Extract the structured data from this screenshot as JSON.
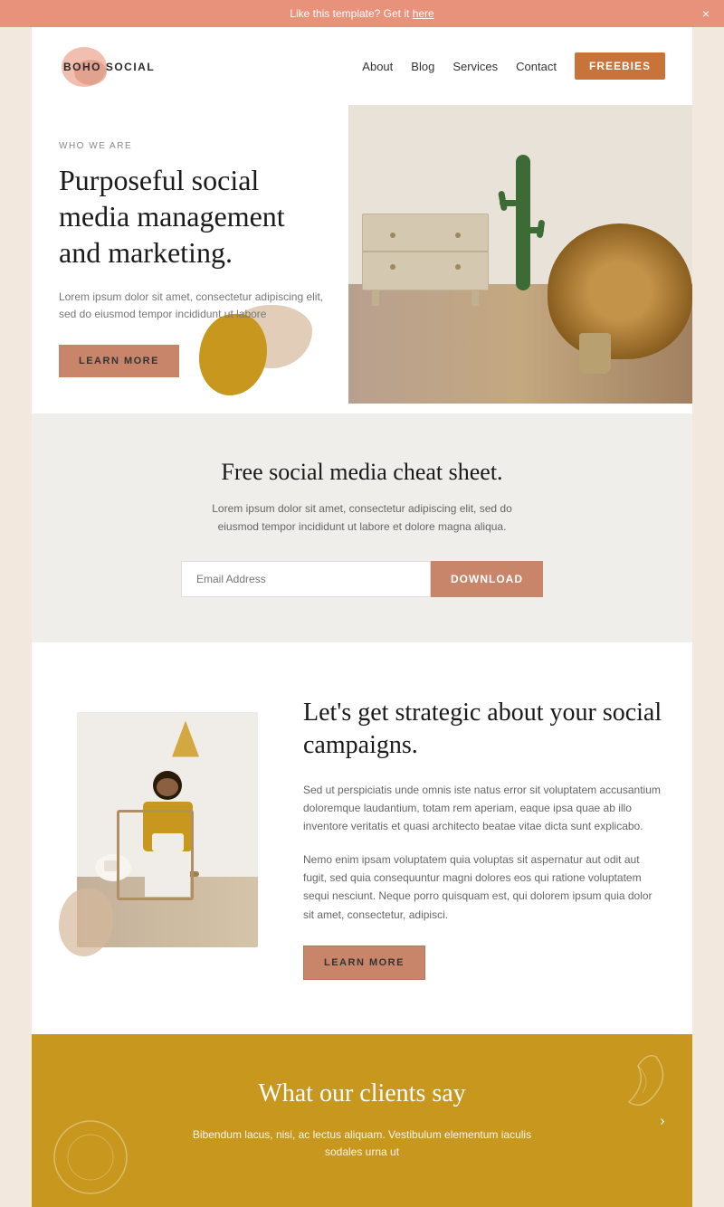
{
  "banner": {
    "text": "Like this template? Get it ",
    "link_text": "here",
    "close_label": "×"
  },
  "navbar": {
    "logo": "BOHO SOCIAL",
    "links": [
      "About",
      "Blog",
      "Services",
      "Contact"
    ],
    "freebies_label": "FREEBIES"
  },
  "hero": {
    "eyebrow": "WHO WE ARE",
    "title": "Purposeful social media management and marketing.",
    "description": "Lorem ipsum dolor sit amet, consectetur adipiscing elit,\nsed do eiusmod tempor incididunt ut labore",
    "cta_label": "LEARN MORE"
  },
  "cheat_sheet": {
    "title": "Free social media cheat sheet.",
    "description": "Lorem ipsum dolor sit amet, consectetur adipiscing elit, sed do eiusmod tempor incididunt ut labore et dolore magna aliqua.",
    "email_placeholder": "Email Address",
    "download_label": "DOWNLOAD"
  },
  "strategic": {
    "title": "Let's get strategic about your social campaigns.",
    "para1": "Sed ut perspiciatis unde omnis iste natus error sit voluptatem accusantium doloremque laudantium, totam rem aperiam, eaque ipsa quae ab illo inventore veritatis et quasi architecto beatae vitae dicta sunt explicabo.",
    "para2": "Nemo enim ipsam voluptatem quia voluptas sit aspernatur aut odit aut fugit, sed quia consequuntur magni dolores eos qui ratione voluptatem sequi nesciunt. Neque porro quisquam est, qui dolorem ipsum quia dolor sit amet, consectetur, adipisci.",
    "cta_label": "LEARN MORE"
  },
  "testimonials": {
    "title": "What our clients say",
    "text": "Bibendum lacus, nisi, ac lectus aliquam. Vestibulum elementum iaculis sodales urna ut"
  },
  "colors": {
    "salmon": "#e8927c",
    "terracotta": "#c8856a",
    "dark_terracotta": "#c8733a",
    "gold": "#c8971e",
    "beige": "#d4b89a",
    "light_bg": "#f2e8de",
    "section_bg": "#f0eeeb"
  }
}
